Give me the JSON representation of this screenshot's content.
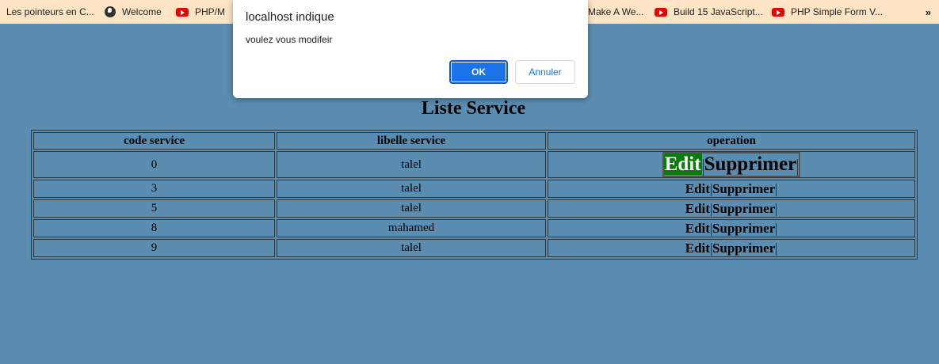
{
  "bookmarks": {
    "items": [
      {
        "label": "Les pointeurs en C...",
        "icon": "none"
      },
      {
        "label": "Welcome",
        "icon": "globe-icon"
      },
      {
        "label": "PHP/M",
        "icon": "youtube-icon"
      },
      {
        "label": "Make A We...",
        "icon": "youtube-icon"
      },
      {
        "label": "Build 15 JavaScript...",
        "icon": "youtube-icon"
      },
      {
        "label": "PHP Simple Form V...",
        "icon": "youtube-icon"
      }
    ],
    "more": "»"
  },
  "page": {
    "title": "Liste Service",
    "columns": [
      "code service",
      "libelle service",
      "operation"
    ],
    "rows": [
      {
        "code": "0",
        "libelle": "talel"
      },
      {
        "code": "3",
        "libelle": "talel"
      },
      {
        "code": "5",
        "libelle": "talel"
      },
      {
        "code": "8",
        "libelle": "mahamed"
      },
      {
        "code": "9",
        "libelle": "talel"
      }
    ],
    "edit_label": "Edit",
    "delete_label": "Supprimer"
  },
  "dialog": {
    "origin": "localhost indique",
    "message": "voulez vous modifeir",
    "ok_label": "OK",
    "cancel_label": "Annuler"
  },
  "colors": {
    "page_background": "#5b8db0",
    "bookmarks_bar": "#fce4c4",
    "edit_highlight": "#0a7a0a",
    "ok_button": "#1a73e8"
  }
}
